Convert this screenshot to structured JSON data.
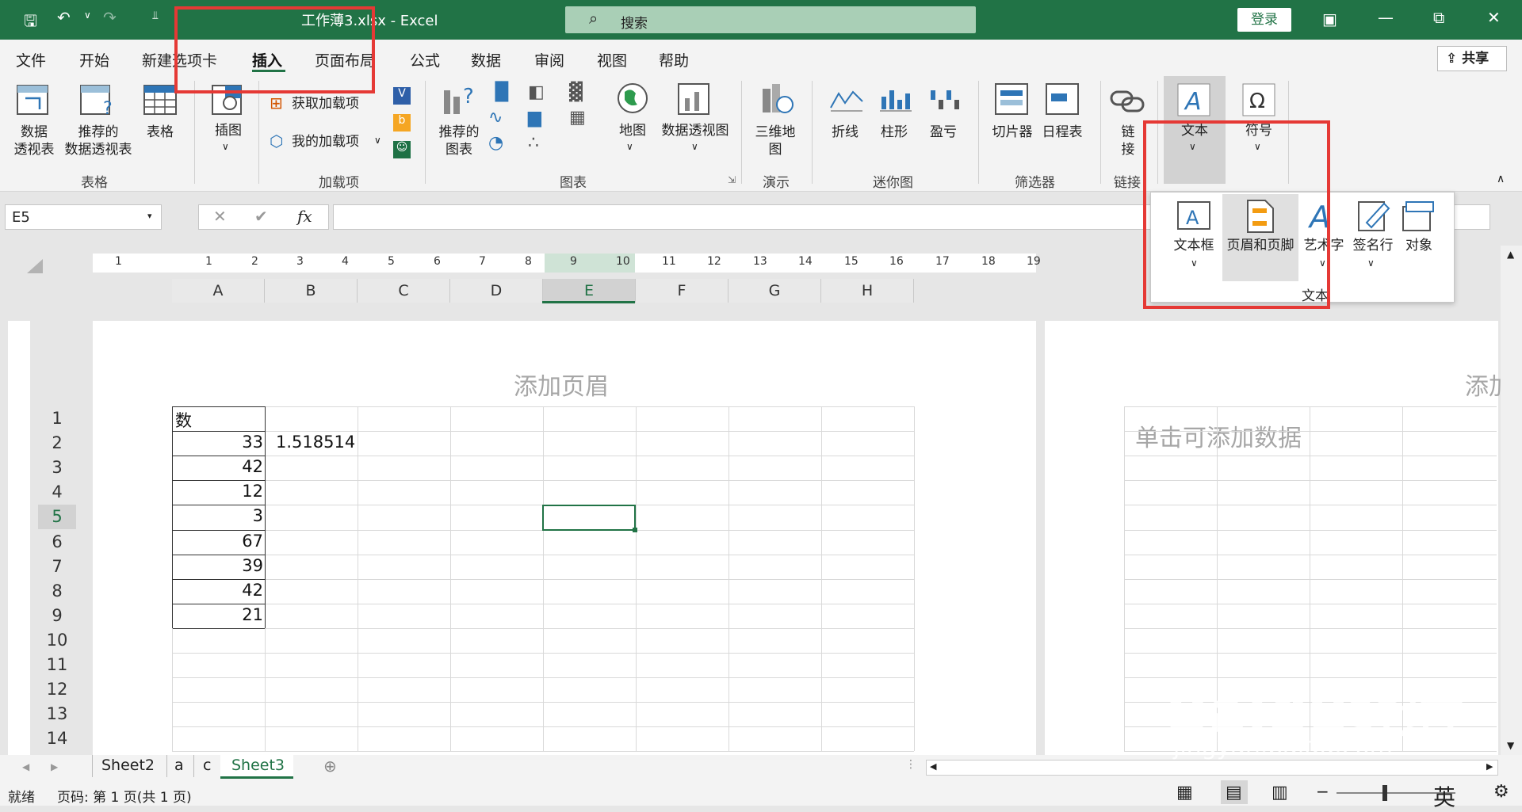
{
  "titlebar": {
    "doc_title": "工作薄3.xlsx  -  Excel",
    "search_label": "搜索",
    "login": "登录"
  },
  "tabs": [
    "文件",
    "开始",
    "新建选项卡",
    "插入",
    "页面布局",
    "公式",
    "数据",
    "审阅",
    "视图",
    "帮助"
  ],
  "share": "共享",
  "ribbon": {
    "table_group": {
      "label": "表格",
      "items": [
        "数据\n透视表",
        "推荐的\n数据透视表",
        "表格"
      ]
    },
    "illustration": {
      "label": "插图"
    },
    "addins_group": {
      "label": "加载项",
      "get": "获取加载项",
      "mine": "我的加载项"
    },
    "recommended_charts": "推荐的\n图表",
    "charts_group": {
      "label": "图表"
    },
    "map": "地图",
    "pivot_chart": "数据透视图",
    "tours": {
      "item": "三维地\n图",
      "label": "演示"
    },
    "sparklines": {
      "label": "迷你图",
      "items": [
        "折线",
        "柱形",
        "盈亏"
      ]
    },
    "filters": {
      "label": "筛选器",
      "items": [
        "切片器",
        "日程表"
      ]
    },
    "links": {
      "item": "链\n接",
      "label": "链接"
    },
    "text_btn": "文本",
    "symbols_btn": "符号"
  },
  "popup": {
    "items": [
      "文本框",
      "页眉和页脚",
      "艺术字",
      "签名行",
      "对象"
    ],
    "label": "文本"
  },
  "namebox": "E5",
  "fx": "fx",
  "ruler": [
    "1",
    "1",
    "2",
    "3",
    "4",
    "5",
    "6",
    "7",
    "8",
    "9",
    "10",
    "11",
    "12",
    "13",
    "14",
    "15",
    "16",
    "17",
    "18",
    "19"
  ],
  "columns": [
    "A",
    "B",
    "C",
    "D",
    "E",
    "F",
    "G",
    "H"
  ],
  "rows": [
    "1",
    "2",
    "3",
    "4",
    "5",
    "6",
    "7",
    "8",
    "9",
    "10",
    "11",
    "12",
    "13",
    "14"
  ],
  "cells": {
    "A1": "数",
    "A2": "33",
    "B2": "1.518514",
    "A3": "42",
    "A4": "12",
    "A5": "3",
    "A6": "67",
    "A7": "39",
    "A8": "42",
    "A9": "21"
  },
  "header_placeholder": "添加页眉",
  "header_placeholder2": "添加",
  "add_data": "单击可添加数据",
  "sheets": [
    "Sheet2",
    "a",
    "c",
    "Sheet3"
  ],
  "active_sheet": "Sheet3",
  "status": {
    "ready": "就绪",
    "page": "页码: 第 1 页(共 1 页)",
    "ime": "英"
  },
  "watermark": "Baidu经验",
  "watermark2": "jingyan.baidu.com",
  "colors": {
    "excel_green": "#217346",
    "highlight_red": "#e53935"
  }
}
